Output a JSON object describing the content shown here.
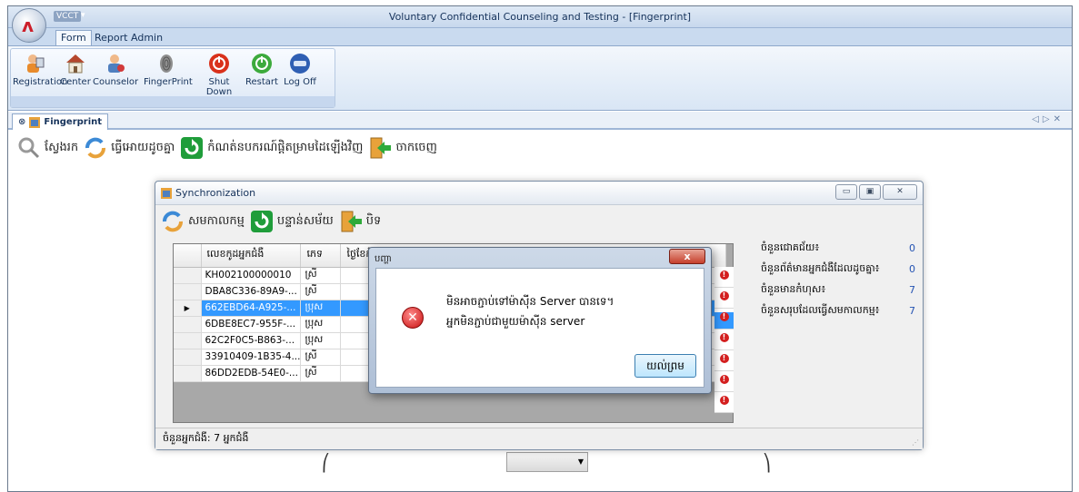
{
  "window": {
    "title": "Voluntary Confidential Counseling and Testing - [Fingerprint]",
    "app_tag": "VCCT"
  },
  "ribbon": {
    "tabs": [
      "Form",
      "Report",
      "Admin"
    ],
    "buttons": [
      {
        "label": "Registration",
        "icon": "registration-icon"
      },
      {
        "label": "Center",
        "icon": "home-icon"
      },
      {
        "label": "Counselor",
        "icon": "counselor-icon"
      },
      {
        "label": "FingerPrint",
        "icon": "fingerprint-icon"
      },
      {
        "label": "Shut Down",
        "icon": "power-icon"
      },
      {
        "label": "Restart",
        "icon": "restart-icon"
      },
      {
        "label": "Log Off",
        "icon": "logoff-icon"
      }
    ]
  },
  "doc_tab": {
    "label": "Fingerprint"
  },
  "toolbar": {
    "search": "ស្វែងរក",
    "sync": "ធ្វើអោយដូចគ្នា",
    "refresh": "កំណត់នបករណ៍ផ្តិតម្រាមដៃឡើងវិញ",
    "exit": "ចាកចេញ"
  },
  "sync_window": {
    "title": "Synchronization",
    "toolbar": {
      "sync": "សមកាលកម្ម",
      "reload": "បន្ទាន់សម័យ",
      "close": "បិទ"
    },
    "columns": [
      "លេខកូដអ្នកជំងឺ",
      "ភេទ",
      "ថ្ងៃខែកំណើ"
    ],
    "rows": [
      {
        "code": "KH002100000010",
        "sex": "ស្រី"
      },
      {
        "code": "DBA8C336-89A9-...",
        "sex": "ស្រី"
      },
      {
        "code": "662EBD64-A925-...",
        "sex": "ប្រុស"
      },
      {
        "code": "6DBE8EC7-955F-...",
        "sex": "ប្រុស"
      },
      {
        "code": "62C2F0C5-B863-...",
        "sex": "ប្រុស"
      },
      {
        "code": "33910409-1B35-4...",
        "sex": "ស្រី"
      },
      {
        "code": "86DD2EDB-54E0-...",
        "sex": "ស្រី"
      }
    ],
    "selected_row": 2,
    "stats": [
      {
        "label": "ចំនួនជោគជ័យ៖",
        "value": "0"
      },
      {
        "label": "ចំនួនព័ត៌មានអ្នកជំងឺដែលដូចគ្នា៖",
        "value": "0"
      },
      {
        "label": "ចំនួនមានកំហុស៖",
        "value": "7"
      },
      {
        "label": "ចំនួនសរុបដែលធ្វើសមកាលកម្ម៖",
        "value": "7"
      }
    ],
    "status": "ចំនួនអ្នកជំងឺ: 7 អ្នកជំងឺ"
  },
  "message_box": {
    "title": "បញ្ហា",
    "line1": "មិនអាចភ្ជាប់ទៅម៉ាស៊ីន Server បានទេ។",
    "line2": "អ្នកមិនភ្ជាប់ជាមួយម៉ាស៊ីន server",
    "ok": "យល់ព្រម",
    "close": "x"
  }
}
